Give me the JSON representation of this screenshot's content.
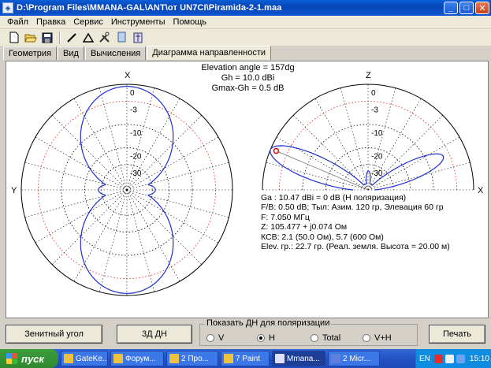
{
  "window": {
    "title": "D:\\Program Files\\MMANA-GAL\\ANT\\от UN7CI\\Piramida-2-1.maa"
  },
  "menu": [
    "Файл",
    "Правка",
    "Сервис",
    "Инструменты",
    "Помощь"
  ],
  "toolbar": [
    "new-file-icon",
    "open-folder-icon",
    "save-icon",
    "draw-line-icon",
    "triangle-icon",
    "tools-icon",
    "copy-icon",
    "antenna-icon"
  ],
  "tabs": [
    "Геометрия",
    "Вид",
    "Вычисления",
    "Диаграмма направленности"
  ],
  "active_tab": "Диаграмма направленности",
  "plot": {
    "header": [
      "Elevation angle = 157dg",
      "Gh = 10.0 dBi",
      "Gmax-Gh = 0.5 dB"
    ],
    "left_axis_top": "X",
    "left_axis_side": "Y",
    "right_axis_top": "Z",
    "right_axis_side": "X",
    "rings_left": [
      "0",
      "-3",
      "-10",
      "-20",
      "-30"
    ],
    "rings_right": [
      "0",
      "-3",
      "-10",
      "-20",
      "-30"
    ],
    "info": [
      "Ga : 10.47 dBi = 0 dB  (H поляризация)",
      "F/B: 0.50 dB; Тыл: Азим. 120 гр, Элевация 60 гр",
      "F: 7.050 МГц",
      "Z: 105.477 + j0.074 Ом",
      "КСВ: 2.1 (50.0 Ом), 5.7 (600 Ом)",
      "Elev. гр.: 22.7 гр. (Реал. земля. Высота = 20.00 м)"
    ],
    "pattern_color": "#1f2fd0",
    "ring_color": "#000000",
    "minus3_color": "#e02020"
  },
  "controls": {
    "zenith_button": "Зенитный угол",
    "3d_button": "3Д  ДН",
    "polarization_group": "Показать ДН для поляризации",
    "radio": [
      "V",
      "H",
      "Total",
      "V+H"
    ],
    "radio_selected": "H",
    "print_button": "Печать"
  },
  "taskbar": {
    "start": "пуск",
    "tasks": [
      "GateKe...",
      "Форум...",
      "2 Про...",
      "7 Paint",
      "Mmana...",
      "2 Micr..."
    ],
    "lang": "EN",
    "clock": "15:10"
  }
}
